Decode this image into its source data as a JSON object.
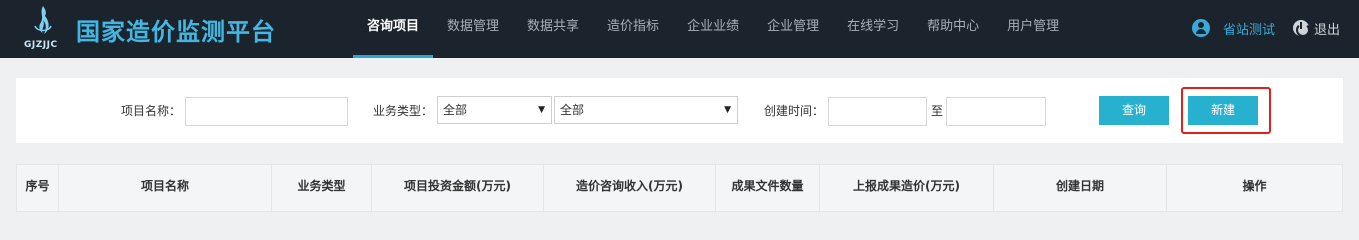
{
  "app": {
    "logo_text": "GJZJJC",
    "title": "国家造价监测平台",
    "accent_color": "#2aa8d0"
  },
  "nav": [
    {
      "label": "咨询项目",
      "active": true
    },
    {
      "label": "数据管理",
      "active": false
    },
    {
      "label": "数据共享",
      "active": false
    },
    {
      "label": "造价指标",
      "active": false
    },
    {
      "label": "企业业绩",
      "active": false
    },
    {
      "label": "企业管理",
      "active": false
    },
    {
      "label": "在线学习",
      "active": false
    },
    {
      "label": "帮助中心",
      "active": false
    },
    {
      "label": "用户管理",
      "active": false
    }
  ],
  "user": {
    "icon": "user-icon",
    "name": "省站测试",
    "logout_icon": "power-icon",
    "logout_label": "退出"
  },
  "filter": {
    "project_name_label": "项目名称：",
    "project_name_value": "",
    "business_type_label": "业务类型：",
    "business_type_select1": "全部",
    "business_type_select2": "全部",
    "created_time_label": "创建时间：",
    "date_from_value": "",
    "to_label": "至",
    "date_to_value": "",
    "query_button": "查询",
    "new_button": "新建",
    "highlight_color": "#e0201c"
  },
  "table": {
    "columns": [
      "序号",
      "项目名称",
      "业务类型",
      "项目投资金额(万元)",
      "造价咨询收入(万元)",
      "成果文件数量",
      "上报成果造价(万元)",
      "创建日期",
      "操作"
    ]
  }
}
